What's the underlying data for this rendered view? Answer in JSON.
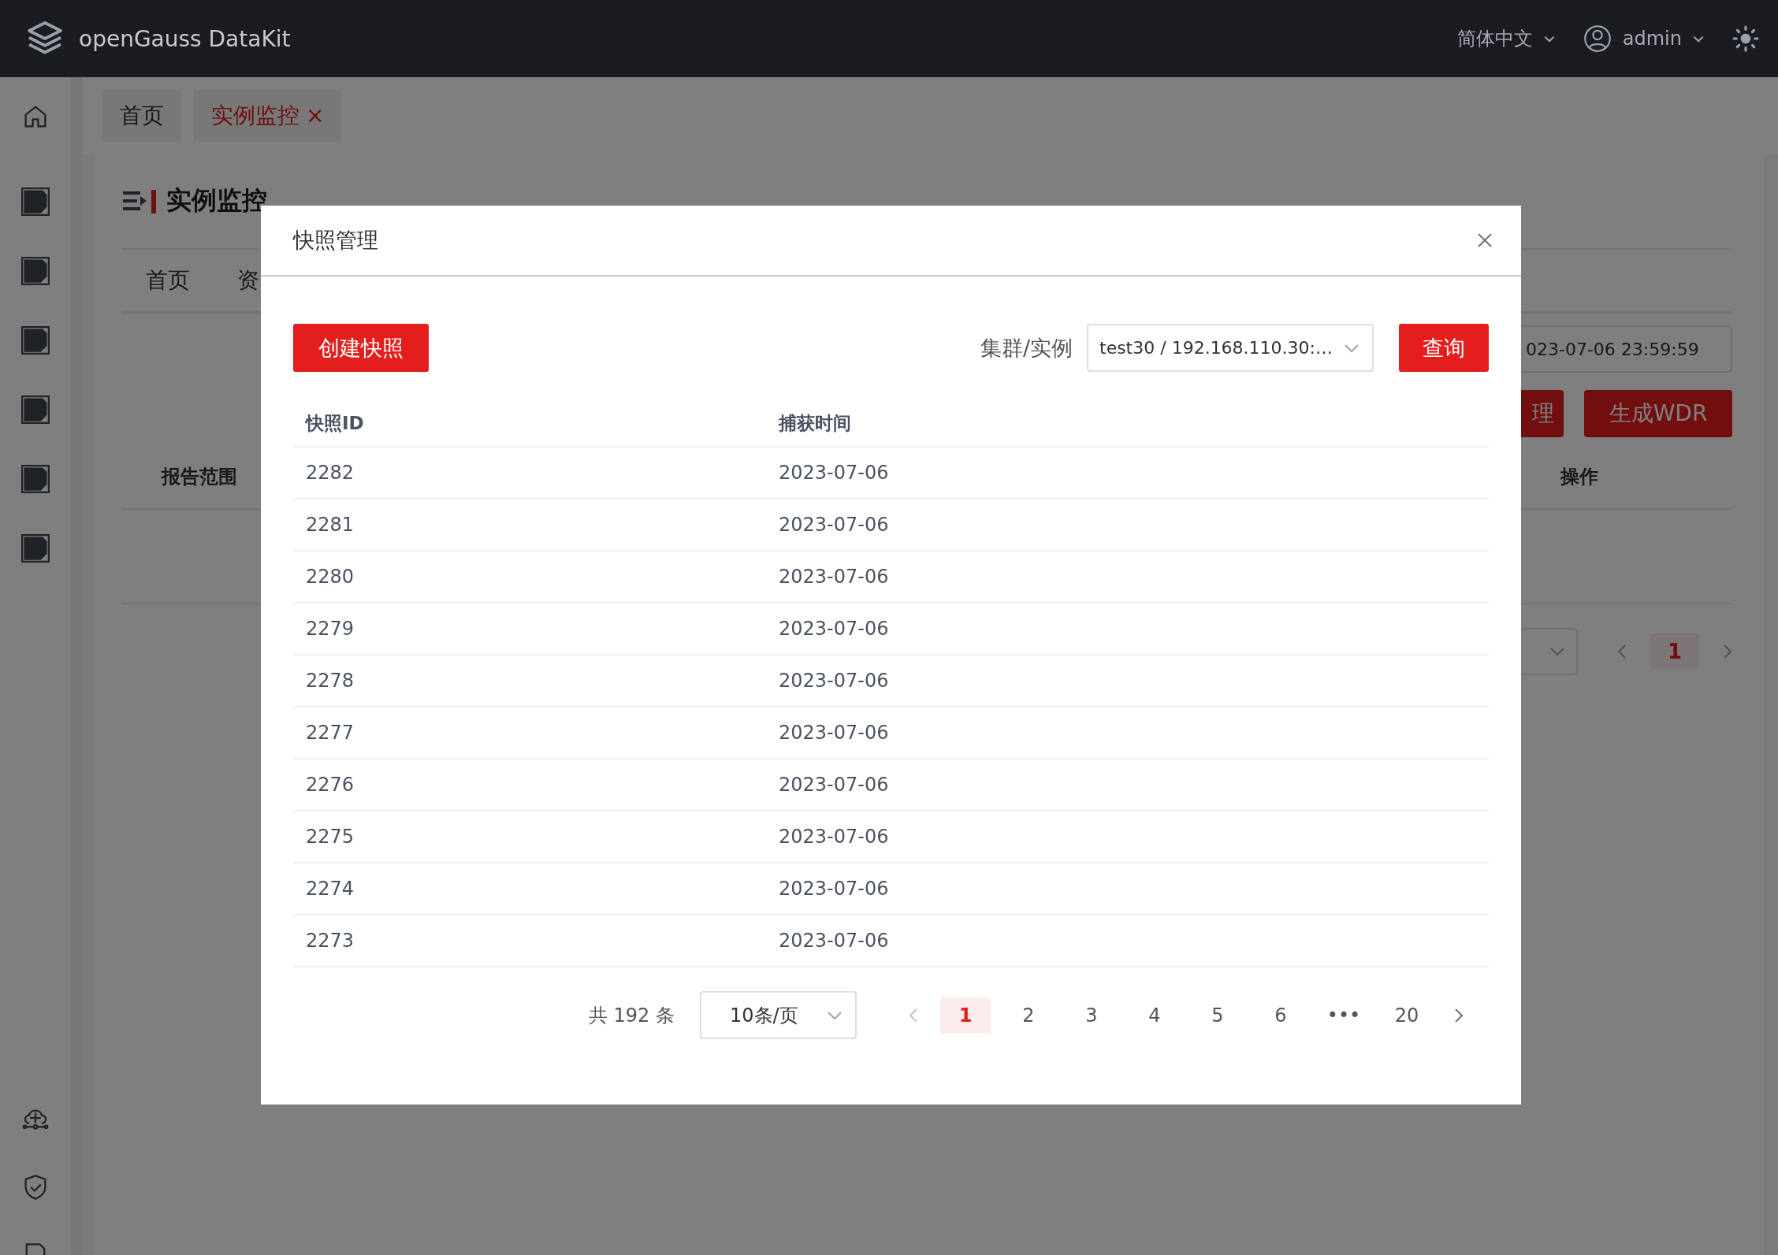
{
  "topbar": {
    "app_name": "openGauss DataKit",
    "language": "简体中文",
    "user": "admin"
  },
  "page_tabs": [
    {
      "label": "首页",
      "selected": false,
      "closable": false
    },
    {
      "label": "实例监控",
      "selected": true,
      "closable": true,
      "close_glyph": "×"
    }
  ],
  "background_page": {
    "title": "实例监控",
    "sub_tabs": [
      {
        "label": "首页"
      },
      {
        "label": "资"
      }
    ],
    "date_field": {
      "value": "023-07-06 23:59:59"
    },
    "buttons": [
      "理",
      "生成WDR"
    ],
    "table": {
      "columns": [
        "报告范围",
        "操作"
      ]
    },
    "pagination": {
      "current": "1"
    }
  },
  "dialog": {
    "title": "快照管理",
    "create_button": "创建快照",
    "filter_label": "集群/实例",
    "instance_select": {
      "value": "test30 / 192.168.110.30:…"
    },
    "query_button": "查询",
    "table": {
      "columns": [
        "快照ID",
        "捕获时间"
      ],
      "rows": [
        {
          "id": "2282",
          "time": "2023-07-06"
        },
        {
          "id": "2281",
          "time": "2023-07-06"
        },
        {
          "id": "2280",
          "time": "2023-07-06"
        },
        {
          "id": "2279",
          "time": "2023-07-06"
        },
        {
          "id": "2278",
          "time": "2023-07-06"
        },
        {
          "id": "2277",
          "time": "2023-07-06"
        },
        {
          "id": "2276",
          "time": "2023-07-06"
        },
        {
          "id": "2275",
          "time": "2023-07-06"
        },
        {
          "id": "2274",
          "time": "2023-07-06"
        },
        {
          "id": "2273",
          "time": "2023-07-06"
        }
      ]
    },
    "pagination": {
      "total": "共 192 条",
      "page_size": "10条/页",
      "pages": [
        {
          "label": "1",
          "selected": true
        },
        {
          "label": "2",
          "selected": false
        },
        {
          "label": "3",
          "selected": false
        },
        {
          "label": "4",
          "selected": false
        },
        {
          "label": "5",
          "selected": false
        },
        {
          "label": "6",
          "selected": false
        },
        {
          "label": "•••",
          "selected": false
        },
        {
          "label": "20",
          "selected": false
        }
      ]
    }
  }
}
